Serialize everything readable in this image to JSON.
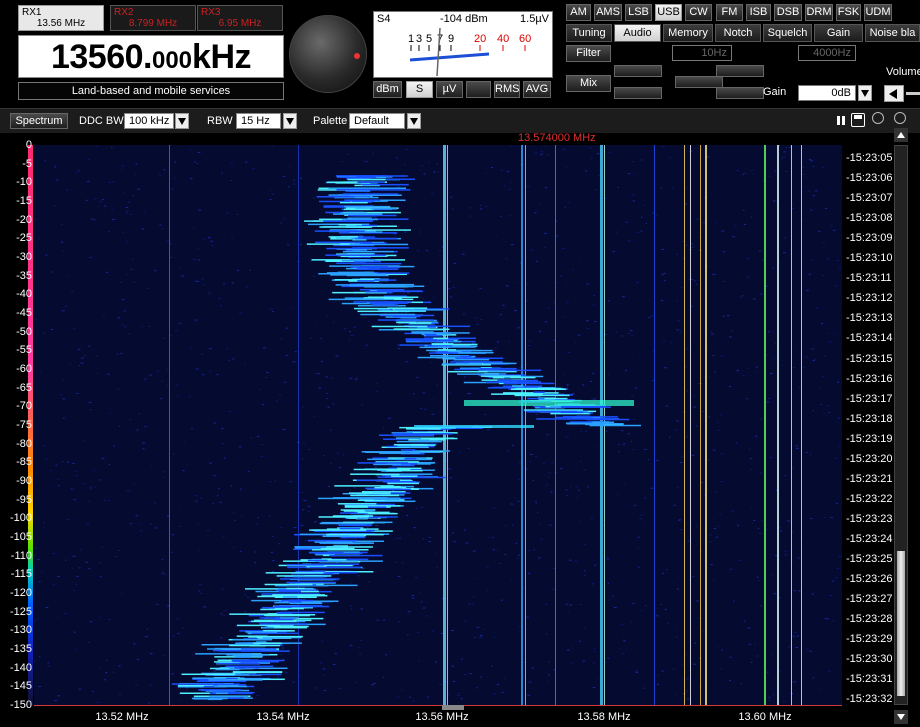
{
  "receivers": [
    {
      "name": "RX1",
      "freq": "13.56 MHz",
      "active": true
    },
    {
      "name": "RX2",
      "freq": "8.799 MHz",
      "active": false
    },
    {
      "name": "RX3",
      "freq": "6.95 MHz",
      "active": false
    }
  ],
  "frequency": {
    "main": "13560.",
    "fraction": "000",
    "unit": "kHz"
  },
  "service_label": "Land-based and mobile services",
  "meter": {
    "unit_label": "S4",
    "reading": "-104 dBm",
    "voltage": "1.5µV",
    "scale_white": [
      "1",
      "3",
      "5",
      "7",
      "9"
    ],
    "scale_red": [
      "20",
      "40",
      "60"
    ],
    "modes": [
      "dBm",
      "S",
      "µV",
      "",
      "RMS",
      "AVG"
    ],
    "active_mode": "S",
    "needle_fraction": 0.3
  },
  "demod_modes": [
    "AM",
    "AMS",
    "LSB",
    "USB",
    "CW",
    "FM",
    "ISB",
    "DSB",
    "DRM",
    "FSK",
    "UDM"
  ],
  "active_demod": "USB",
  "tabs": [
    "Tuning",
    "Audio",
    "Memory",
    "Notch",
    "Squelch",
    "Gain",
    "Noise bla"
  ],
  "active_tab": "Audio",
  "audio": {
    "filter_label": "Filter",
    "mix_label": "Mix",
    "filter_low": "10Hz",
    "filter_high": "4000Hz",
    "gain_label": "Gain",
    "gain_value": "0dB",
    "volume_label": "Volume"
  },
  "toolbar": {
    "spectrum_btn": "Spectrum",
    "ddc_label": "DDC BW",
    "ddc_value": "100 kHz",
    "rbw_label": "RBW",
    "rbw_value": "15 Hz",
    "palette_label": "Palette",
    "palette_value": "Default"
  },
  "marker_freq": "13.574000 MHz",
  "y_ticks": [
    "0",
    "-5",
    "-10",
    "-15",
    "-20",
    "-25",
    "-30",
    "-35",
    "-40",
    "-45",
    "-50",
    "-55",
    "-60",
    "-65",
    "-70",
    "-75",
    "-80",
    "-85",
    "-90",
    "-95",
    "-100",
    "-105",
    "-110",
    "-115",
    "-120",
    "-125",
    "-130",
    "-135",
    "-140",
    "-145",
    "-150"
  ],
  "time_ticks": [
    "15:23:05",
    "15:23:06",
    "15:23:07",
    "15:23:08",
    "15:23:09",
    "15:23:10",
    "15:23:11",
    "15:23:12",
    "15:23:13",
    "15:23:14",
    "15:23:15",
    "15:23:16",
    "15:23:17",
    "15:23:18",
    "15:23:19",
    "15:23:20",
    "15:23:21",
    "15:23:22",
    "15:23:23",
    "15:23:24",
    "15:23:25",
    "15:23:26",
    "15:23:27",
    "15:23:28",
    "15:23:29",
    "15:23:30",
    "15:23:31",
    "15:23:32"
  ],
  "x_ticks": [
    "13.52 MHz",
    "13.54 MHz",
    "13.56 MHz",
    "13.58 MHz",
    "13.60 MHz"
  ],
  "colors": {
    "background": "#000000",
    "waterfall_bg": "#050a30",
    "marker": "#d43a3a",
    "accent_red": "#e02020"
  }
}
